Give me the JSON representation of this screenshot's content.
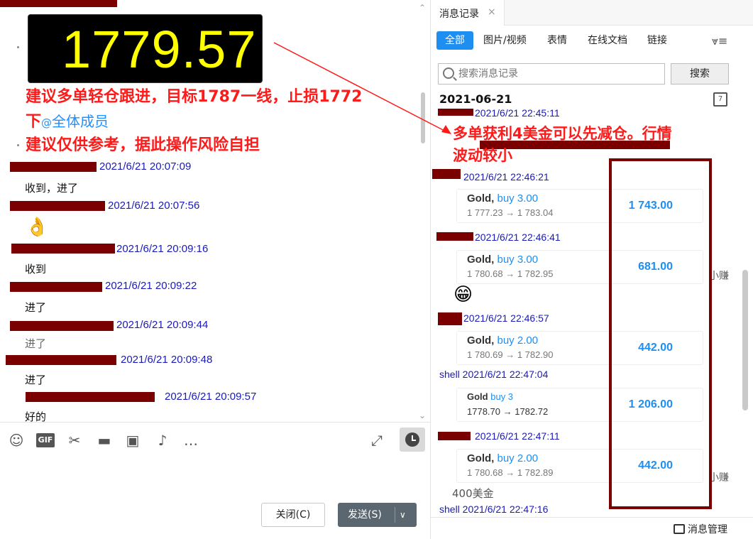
{
  "left": {
    "price": "1779.57",
    "advice_line1": "建议多单轻仓跟进，目标1787一线，止损1772",
    "advice_line2_prefix": "下",
    "mention_at": "@",
    "mention_all": "全体成员",
    "advice_line3": "建议仅供参考，据此操作风险自担",
    "messages": [
      {
        "time": "2021/6/21 20:07:09",
        "text": "收到，进了"
      },
      {
        "time": "2021/6/21 20:07:56",
        "text": ""
      },
      {
        "time": "2021/6/21 20:09:16",
        "text": "收到"
      },
      {
        "time": "2021/6/21 20:09:22",
        "text": "进了"
      },
      {
        "time": "2021/6/21 20:09:44",
        "text": "进了"
      },
      {
        "time": "2021/6/21 20:09:48",
        "text": "进了"
      },
      {
        "time": "2021/6/21 20:09:57",
        "text": "好的"
      }
    ],
    "ok_emoji": "👌",
    "close_btn": "关闭(C)",
    "send_btn": "发送(S)",
    "gif_label": "GIF"
  },
  "right": {
    "tab_title": "消息记录",
    "filters": [
      "全部",
      "图片/视频",
      "表情",
      "在线文档",
      "链接"
    ],
    "search_placeholder": "搜索消息记录",
    "search_btn": "搜索",
    "date": "2021-06-21",
    "cal_day": "7",
    "msg0_time": "2021/6/21 22:45:11",
    "annotation_line1": "多单获利4美金可以先减仓。行情",
    "annotation_line2": "波动较小",
    "trades": [
      {
        "time": "2021/6/21 22:46:21",
        "symbol": "Gold,",
        "side": "buy 3.00",
        "prices": "1 777.23 → 1 783.04",
        "pnl": "1 743.00"
      },
      {
        "time": "2021/6/21 22:46:41",
        "symbol": "Gold,",
        "side": "buy 3.00",
        "prices": "1 780.68 → 1 782.95",
        "pnl": "681.00"
      },
      {
        "time": "2021/6/21 22:46:57",
        "symbol": "Gold,",
        "side": "buy 2.00",
        "prices": "1 780.69 → 1 782.90",
        "pnl": "442.00"
      },
      {
        "time": "shell 2021/6/21 22:47:04",
        "symbol": "Gold",
        "side": "buy 3",
        "prices": "1778.70 → 1782.72",
        "pnl": "1 206.00"
      },
      {
        "time": "2021/6/21 22:47:11",
        "symbol": "Gold,",
        "side": "buy 2.00",
        "prices": "1 780.68 → 1 782.89",
        "pnl": "442.00"
      }
    ],
    "grin_emoji": "😁",
    "side_note1": "小赚",
    "side_note2": "小赚",
    "profit_text": "400美金",
    "last_msg_time": "shell 2021/6/21 22:47:16",
    "msg_manager": "消息管理"
  }
}
